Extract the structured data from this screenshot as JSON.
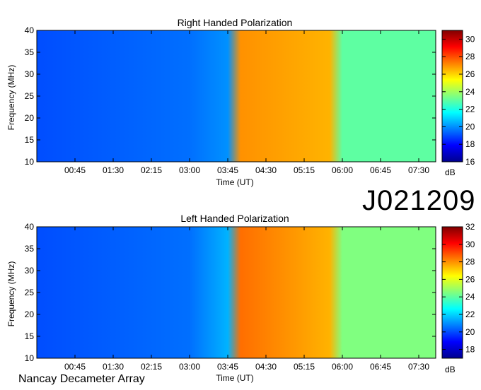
{
  "observation_id": "J021209",
  "instrument": "Nancay Decameter Array",
  "colorbar_unit": "dB",
  "chart_data": [
    {
      "type": "heatmap",
      "title": "Right Handed Polarization",
      "xlabel": "Time (UT)",
      "ylabel": "Frequency (MHz)",
      "x_ticks": [
        "00:45",
        "01:30",
        "02:15",
        "03:00",
        "03:45",
        "04:30",
        "05:15",
        "06:00",
        "06:45",
        "07:30"
      ],
      "y_ticks": [
        10,
        15,
        20,
        25,
        30,
        35,
        40
      ],
      "ylim": [
        10,
        40
      ],
      "colorbar": {
        "label": "dB",
        "range": [
          16,
          31
        ],
        "ticks": [
          16,
          18,
          20,
          22,
          24,
          26,
          28,
          30
        ]
      },
      "levels": [
        {
          "time": "00:00",
          "db": 19
        },
        {
          "time": "03:00",
          "db": 19.5
        },
        {
          "time": "03:45",
          "db": 20
        },
        {
          "time": "04:00",
          "db": 27
        },
        {
          "time": "05:45",
          "db": 26.5
        },
        {
          "time": "06:00",
          "db": 23
        },
        {
          "time": "07:50",
          "db": 23
        }
      ]
    },
    {
      "type": "heatmap",
      "title": "Left Handed Polarization",
      "xlabel": "Time (UT)",
      "ylabel": "Frequency (MHz)",
      "x_ticks": [
        "00:45",
        "01:30",
        "02:15",
        "03:00",
        "03:45",
        "04:30",
        "05:15",
        "06:00",
        "06:45",
        "07:30"
      ],
      "y_ticks": [
        10,
        15,
        20,
        25,
        30,
        35,
        40
      ],
      "ylim": [
        10,
        40
      ],
      "colorbar": {
        "label": "dB",
        "range": [
          17,
          32
        ],
        "ticks": [
          18,
          20,
          22,
          24,
          26,
          28,
          30,
          32
        ]
      },
      "levels": [
        {
          "time": "00:00",
          "db": 20
        },
        {
          "time": "03:00",
          "db": 20.5
        },
        {
          "time": "03:45",
          "db": 21.5
        },
        {
          "time": "04:00",
          "db": 28.5
        },
        {
          "time": "05:45",
          "db": 27.5
        },
        {
          "time": "06:00",
          "db": 24.5
        },
        {
          "time": "07:50",
          "db": 24.5
        }
      ]
    }
  ]
}
